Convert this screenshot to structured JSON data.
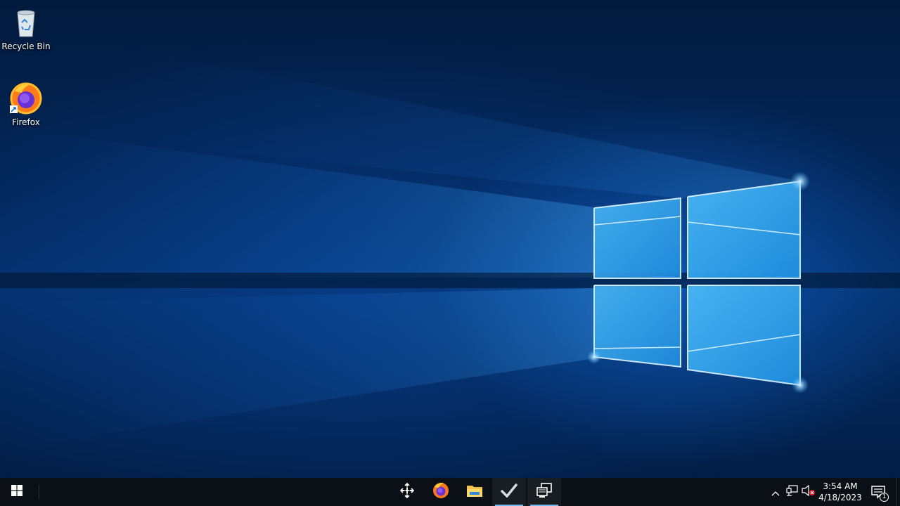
{
  "desktop": {
    "icons": [
      {
        "label": "Recycle Bin",
        "icon": "recycle-bin-icon"
      },
      {
        "label": "Firefox",
        "icon": "firefox-icon"
      }
    ]
  },
  "taskbar": {
    "start_icon": "windows-logo-icon",
    "pinned": [
      {
        "icon": "move-cursor-icon"
      },
      {
        "icon": "firefox-icon"
      },
      {
        "icon": "file-explorer-icon"
      },
      {
        "icon": "checkmark-app-icon"
      },
      {
        "icon": "remote-desktop-icon"
      }
    ],
    "tray": {
      "chevron_icon": "chevron-up-icon",
      "network_icon": "network-icon",
      "volume_icon": "volume-muted-icon",
      "time": "3:54 AM",
      "date": "4/18/2023",
      "notification_count": "1"
    }
  },
  "colors": {
    "taskbar_bg": "#0b1016",
    "accent": "#76b9ed"
  }
}
